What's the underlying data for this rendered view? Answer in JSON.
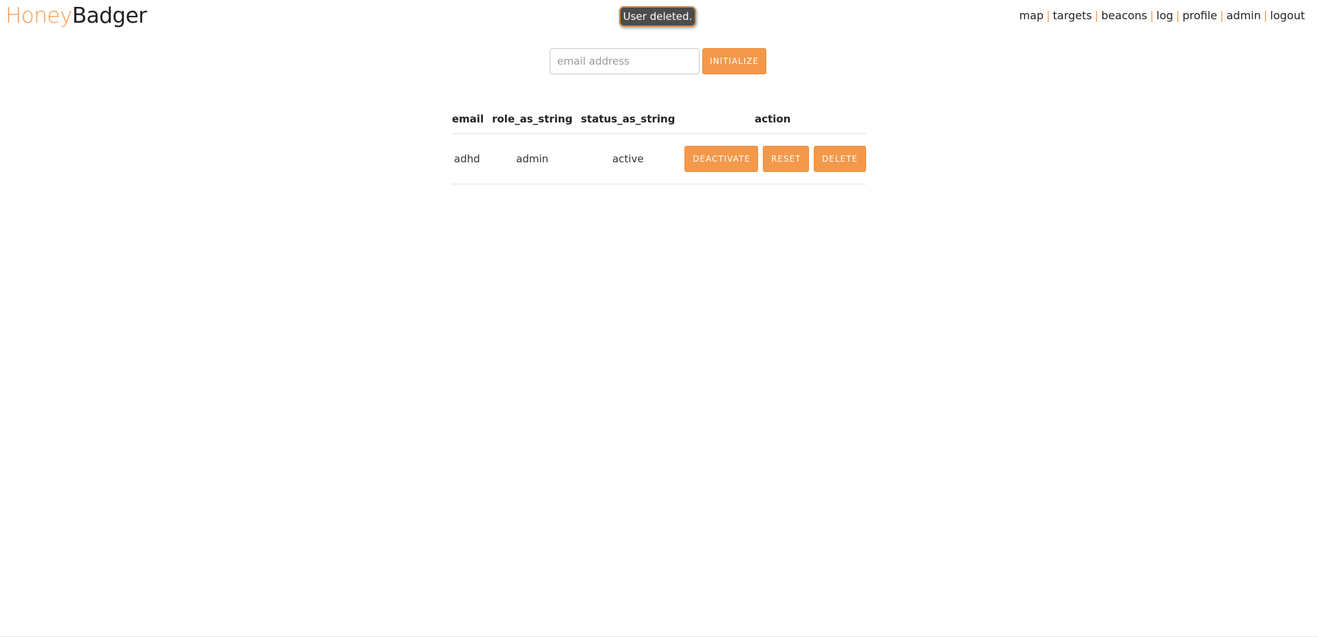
{
  "brand": {
    "part1": "Honey",
    "part2": "Badger"
  },
  "flash_message": "User deleted.",
  "nav": {
    "items": [
      "map",
      "targets",
      "beacons",
      "log",
      "profile",
      "admin",
      "logout"
    ],
    "separator": "|"
  },
  "create_user": {
    "email_placeholder": "email address",
    "email_value": "",
    "button_label": "INITIALIZE"
  },
  "users_table": {
    "columns": [
      "email",
      "role_as_string",
      "status_as_string",
      "action"
    ],
    "rows": [
      {
        "email": "adhd",
        "role": "admin",
        "status": "active",
        "actions": [
          "DEACTIVATE",
          "RESET",
          "DELETE"
        ]
      }
    ]
  },
  "colors": {
    "accent": "#f4994a",
    "flash_bg": "#4c4c4c",
    "text": "#222222"
  }
}
